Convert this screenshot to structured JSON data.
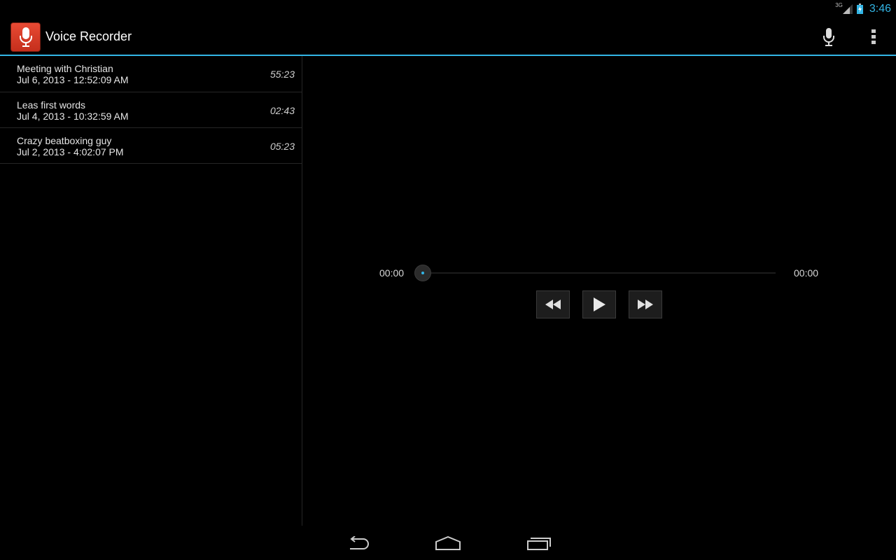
{
  "status_bar": {
    "network_type": "3G",
    "time": "3:46",
    "clock_color": "#33b5e5"
  },
  "action_bar": {
    "title": "Voice Recorder",
    "app_icon": "microphone-app-icon",
    "actions": [
      {
        "icon": "microphone-icon"
      },
      {
        "icon": "overflow-menu-icon"
      }
    ],
    "accent_color": "#33b5e5"
  },
  "recordings": [
    {
      "title": "Meeting with Christian",
      "date": "Jul 6, 2013 - 12:52:09 AM",
      "duration": "55:23"
    },
    {
      "title": "Leas first words",
      "date": "Jul 4, 2013 - 10:32:59 AM",
      "duration": "02:43"
    },
    {
      "title": "Crazy beatboxing guy",
      "date": "Jul 2, 2013 - 4:02:07 PM",
      "duration": "05:23"
    }
  ],
  "player": {
    "elapsed": "00:00",
    "total": "00:00",
    "progress": 0,
    "controls": [
      "rewind-icon",
      "play-icon",
      "fast-forward-icon"
    ]
  },
  "navigation_bar": {
    "buttons": [
      "back-icon",
      "home-icon",
      "recent-apps-icon"
    ]
  }
}
